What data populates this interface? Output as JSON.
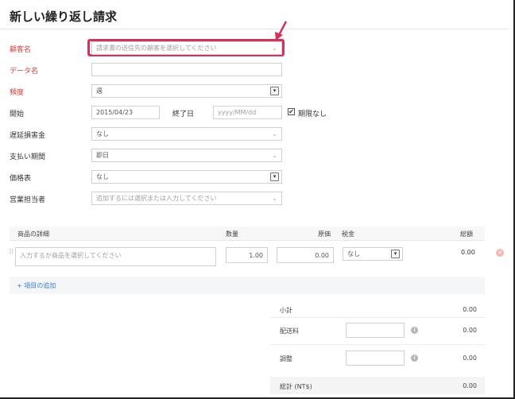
{
  "page": {
    "title": "新しい繰り返し請求"
  },
  "form": {
    "customer": {
      "label": "顧客名",
      "placeholder": "請求書の送信先の顧客を選択してください"
    },
    "profile_name": {
      "label": "データ名",
      "value": ""
    },
    "frequency": {
      "label": "頻度",
      "value": "週"
    },
    "start": {
      "label": "開始",
      "value": "2015/04/23"
    },
    "end": {
      "label": "終了日",
      "placeholder": "yyyy/MM/dd"
    },
    "no_end": {
      "label": "期限なし",
      "checked": true,
      "mark": "✔"
    },
    "late_fee": {
      "label": "遅延損害金",
      "value": "なし"
    },
    "payment_terms": {
      "label": "支払い期間",
      "value": "即日"
    },
    "price_list": {
      "label": "価格表",
      "value": "なし"
    },
    "salesperson": {
      "label": "営業担当者",
      "placeholder": "追加するには選択または入力してください"
    }
  },
  "items": {
    "headers": [
      "商品の詳細",
      "数量",
      "原価",
      "税金",
      "総額"
    ],
    "row": {
      "placeholder": "入力するか商品を選択してください",
      "quantity": "1.00",
      "rate": "0.00",
      "tax": "なし",
      "amount": "0.00"
    },
    "add_label": "+ 項目の追加"
  },
  "totals": {
    "subtotal_label": "小計",
    "subtotal": "0.00",
    "shipping_label": "配送料",
    "shipping": "0.00",
    "adjustment_label": "調整",
    "adjustment": "0.00",
    "total_label": "総計 (NT$)",
    "total": "0.00"
  },
  "glyphs": {
    "chevron": "⌄",
    "select": "▾",
    "drag": "⠿",
    "close": "✕",
    "info": "i"
  },
  "colors": {
    "required": "#d0413c",
    "highlight": "#d2335c",
    "link": "#3c7bd0"
  }
}
